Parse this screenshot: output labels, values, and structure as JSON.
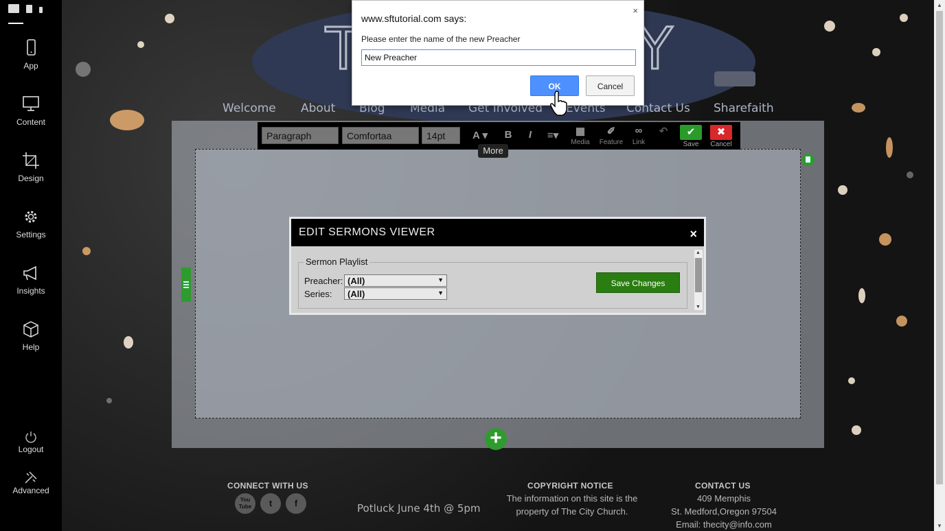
{
  "sidebar": {
    "items": [
      {
        "label": "App",
        "icon": "phone-icon"
      },
      {
        "label": "Content",
        "icon": "monitor-icon"
      },
      {
        "label": "Design",
        "icon": "crop-icon"
      },
      {
        "label": "Settings",
        "icon": "gear-icon"
      },
      {
        "label": "Insights",
        "icon": "megaphone-icon"
      },
      {
        "label": "Help",
        "icon": "box-icon"
      },
      {
        "label": "Logout",
        "icon": "power-icon"
      },
      {
        "label": "Advanced",
        "icon": "tools-icon"
      }
    ]
  },
  "nav": {
    "items": [
      "Welcome",
      "About",
      "Blog",
      "Media",
      "Get Involved",
      "Events",
      "Contact Us",
      "Sharefaith"
    ]
  },
  "toolbar": {
    "format": "Paragraph",
    "font": "Comfortaa",
    "size": "14pt",
    "font_color_glyph": "A",
    "bold_glyph": "B",
    "italic_glyph": "I",
    "media_label": "Media",
    "feature_label": "Feature",
    "link_label": "Link",
    "save_label": "Save",
    "cancel_label": "Cancel",
    "more_label": "More"
  },
  "modal": {
    "title": "EDIT SERMONS VIEWER",
    "fieldset_legend": "Sermon Playlist",
    "preacher_label": "Preacher:",
    "preacher_value": "(All)",
    "series_label": "Series:",
    "series_value": "(All)",
    "save_button": "Save Changes",
    "close_glyph": "×"
  },
  "prompt": {
    "title": "www.sftutorial.com says:",
    "message": "Please enter the name of the new Preacher",
    "input_value": "New Preacher",
    "ok_label": "OK",
    "cancel_label": "Cancel",
    "close_glyph": "×"
  },
  "footer": {
    "connect_heading": "CONNECT WITH US",
    "copyright_heading": "COPYRIGHT NOTICE",
    "copyright_line1": "The information on this site is the",
    "copyright_line2": "property of The City Church.",
    "contact_heading": "CONTACT US",
    "contact_line1": "409 Memphis",
    "contact_line2": "St. Medford,Oregon 97504",
    "contact_line3": "Email: thecity@info.com",
    "event_text": "Potluck June 4th @ 5pm",
    "social": [
      {
        "name": "youtube",
        "glyph": "You Tube"
      },
      {
        "name": "twitter",
        "glyph": "t"
      },
      {
        "name": "facebook",
        "glyph": "f"
      }
    ]
  },
  "colors": {
    "accent_green": "#2e9b2e",
    "ok_blue": "#4d90fe",
    "cancel_red": "#d9282a",
    "header_ellipse": "#2f3a55"
  }
}
